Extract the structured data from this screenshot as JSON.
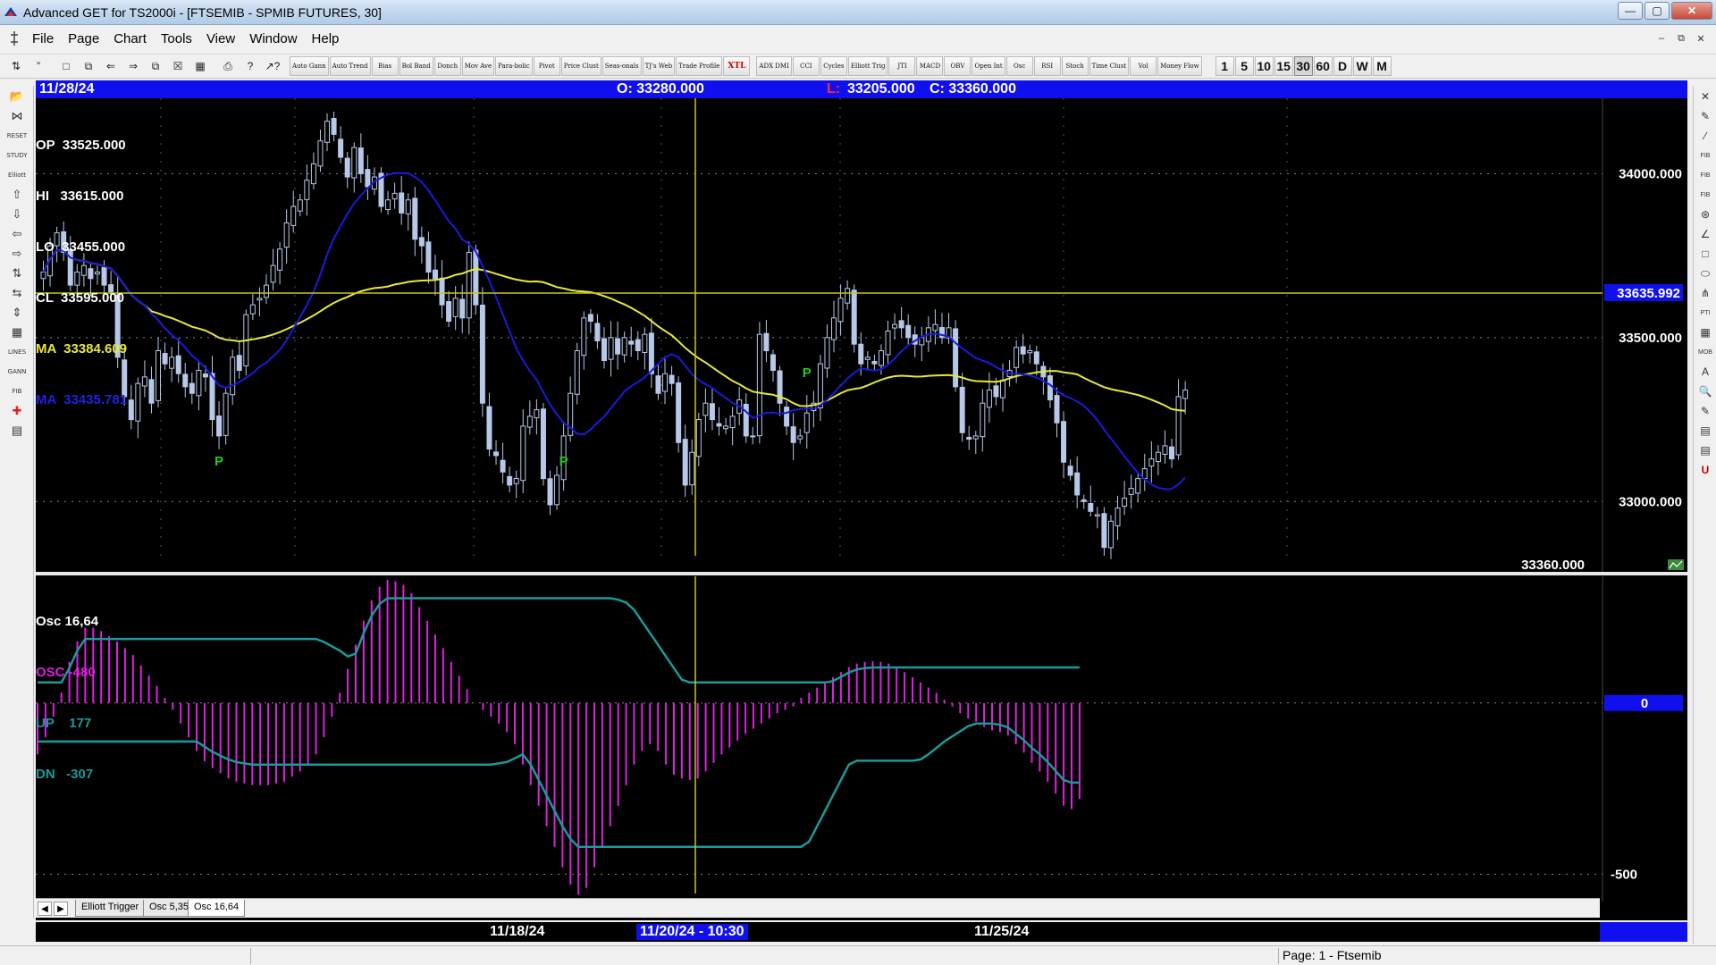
{
  "window": {
    "title": "Advanced GET for TS2000i - [FTSEMIB - SPMIB FUTURES, 30]"
  },
  "menu": {
    "items": [
      "File",
      "Page",
      "Chart",
      "Tools",
      "View",
      "Window",
      "Help"
    ]
  },
  "toolbar": {
    "study_buttons": [
      "Auto Gann",
      "Auto Trend",
      "Bias",
      "Bol Band",
      "Donch",
      "Mov Ave",
      "Para-bolic",
      "Pivot",
      "Price Clust",
      "Seas-onals",
      "TJ's Web",
      "Trade Profile",
      "XTL"
    ],
    "indicator_buttons": [
      "ADX DMI",
      "CCI",
      "Cycles",
      "Elliott Trig",
      "JTI",
      "MACD",
      "OBV",
      "Open Int",
      "Osc",
      "RSI",
      "Stoch",
      "Time Clust",
      "Vol",
      "Money Flow"
    ],
    "periods": [
      "1",
      "5",
      "10",
      "15",
      "30",
      "60",
      "D",
      "W",
      "M"
    ],
    "active_period": "30"
  },
  "info_bar": {
    "date": "11/28/24",
    "open": "O: 33280.000",
    "low_label": "L:",
    "low": "33205.000",
    "close": "C: 33360.000"
  },
  "main_legend": {
    "op": "OP  33525.000",
    "hi": "HI   33615.000",
    "lo": "LO  33455.000",
    "cl": "CL  33595.000",
    "ma1": "MA  33384.609",
    "ma2": "MA  33435.781"
  },
  "price_axis": {
    "labels": [
      "34000.000",
      "33500.000",
      "33000.000"
    ],
    "values": [
      34000,
      33500,
      33000
    ],
    "cursor_price": "33635.992",
    "cursor_value": 33635.992,
    "last_price": "33360.000"
  },
  "osc_legend": {
    "title": "Osc 16,64",
    "osc": "OSC -480",
    "up": "UP    177",
    "dn": "DN   -307"
  },
  "osc_axis": {
    "labels": [
      "0",
      "-500"
    ],
    "values": [
      0,
      -500
    ]
  },
  "tabs": [
    "Elliott Trigger",
    "Osc 5,35",
    "Osc 16,64"
  ],
  "active_tab": "Osc 16,64",
  "date_axis": {
    "labels": [
      "11/18/24",
      "11/25/24"
    ],
    "cursor": "11/20/24 - 10:30"
  },
  "status": {
    "page": "Page: 1 - Ftsemib"
  },
  "colors": {
    "background": "#000000",
    "candle": "#b8c8e8",
    "ma_fast": "#1a1adc",
    "ma_slow": "#e8e83a",
    "oscillator": "#e020e0",
    "bands": "#1a9a9a",
    "pivot": "#22cc22",
    "cursor_line": "#c8c818",
    "info_bar": "#1010ee"
  },
  "chart_data": [
    {
      "type": "candlestick",
      "title": "FTSEMIB - SPMIB FUTURES, 30",
      "ylim": [
        32780,
        34230
      ],
      "closes": [
        33700,
        33780,
        33820,
        33760,
        33660,
        33700,
        33720,
        33680,
        33700,
        33660,
        33640,
        33440,
        33320,
        33250,
        33360,
        33380,
        33300,
        33460,
        33420,
        33440,
        33390,
        33350,
        33330,
        33400,
        33380,
        33250,
        33200,
        33330,
        33440,
        33400,
        33570,
        33600,
        33620,
        33660,
        33720,
        33770,
        33850,
        33900,
        33920,
        33980,
        34030,
        34100,
        34160,
        34120,
        34050,
        33990,
        34080,
        34000,
        33960,
        33990,
        33900,
        33920,
        33940,
        33880,
        33920,
        33800,
        33780,
        33700,
        33680,
        33600,
        33550,
        33620,
        33560,
        33760,
        33600,
        33300,
        33160,
        33140,
        33090,
        33050,
        33070,
        33230,
        33260,
        33280,
        33070,
        32990,
        33080,
        33200,
        33330,
        33460,
        33560,
        33550,
        33490,
        33430,
        33500,
        33450,
        33500,
        33480,
        33460,
        33510,
        33390,
        33330,
        33390,
        33360,
        33180,
        33050,
        33150,
        33250,
        33300,
        33250,
        33230,
        33230,
        33260,
        33310,
        33200,
        33200,
        33510,
        33460,
        33400,
        33300,
        33230,
        33180,
        33200,
        33270,
        33300,
        33420,
        33500,
        33560,
        33620,
        33650,
        33480,
        33420,
        33440,
        33420,
        33460,
        33520,
        33540,
        33530,
        33500,
        33480,
        33500,
        33530,
        33540,
        33500,
        33530,
        33350,
        33210,
        33190,
        33200,
        33300,
        33340,
        33320,
        33370,
        33400,
        33470,
        33450,
        33460,
        33420,
        33380,
        33310,
        33240,
        33120,
        33080,
        33020,
        33000,
        32970,
        32960,
        32860,
        32940,
        32980,
        33010,
        33040,
        33070,
        33100,
        33130,
        33150,
        33170,
        33130,
        33320,
        33340
      ]
    },
    {
      "type": "bar",
      "title": "Osc 16,64",
      "ylim": [
        -580,
        370
      ],
      "values": [
        -150,
        -100,
        -40,
        30,
        120,
        180,
        220,
        220,
        210,
        195,
        180,
        160,
        140,
        110,
        80,
        50,
        15,
        -20,
        -60,
        -100,
        -140,
        -170,
        -190,
        -205,
        -220,
        -230,
        -235,
        -240,
        -240,
        -240,
        -235,
        -230,
        -215,
        -200,
        -180,
        -150,
        -100,
        -40,
        30,
        100,
        170,
        240,
        300,
        340,
        360,
        355,
        345,
        320,
        280,
        240,
        200,
        160,
        120,
        80,
        40,
        0,
        -20,
        -40,
        -60,
        -85,
        -120,
        -180,
        -240,
        -300,
        -360,
        -420,
        -480,
        -530,
        -560,
        -540,
        -480,
        -420,
        -360,
        -300,
        -240,
        -180,
        -140,
        -120,
        -140,
        -180,
        -210,
        -220,
        -225,
        -220,
        -200,
        -175,
        -150,
        -130,
        -110,
        -90,
        -75,
        -60,
        -45,
        -30,
        -20,
        -10,
        15,
        30,
        45,
        60,
        75,
        90,
        105,
        115,
        120,
        122,
        120,
        115,
        105,
        90,
        75,
        60,
        45,
        30,
        10,
        -10,
        -30,
        -45,
        -55,
        -70,
        -80,
        -85,
        -95,
        -120,
        -145,
        -175,
        -200,
        -230,
        -265,
        -300,
        -310,
        -280
      ]
    }
  ]
}
